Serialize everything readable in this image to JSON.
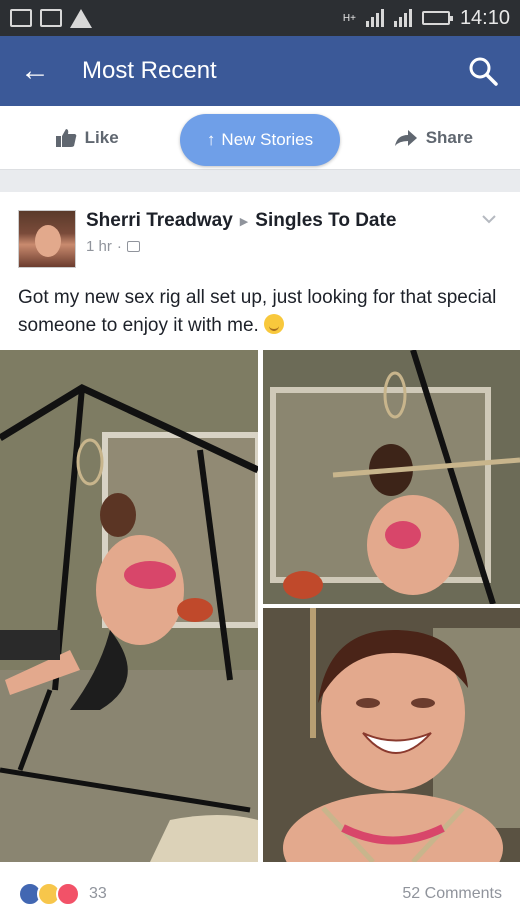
{
  "status_bar": {
    "network": "H+",
    "time": "14:10"
  },
  "nav": {
    "title": "Most Recent",
    "back_icon": "arrow-left-icon",
    "search_icon": "search-icon"
  },
  "action_bar": {
    "like_label": "Like",
    "share_label": "Share",
    "new_stories_label": "New Stories"
  },
  "post": {
    "author": "Sherri Treadway",
    "group": "Singles To Date",
    "time": "1 hr",
    "text": "Got my new sex rig all set up, just looking for that special someone to enjoy it with me.",
    "reaction_count": "33",
    "comments": "52 Comments"
  },
  "colors": {
    "facebook_blue": "#3b5998",
    "pill_blue": "#6f9fe8"
  }
}
